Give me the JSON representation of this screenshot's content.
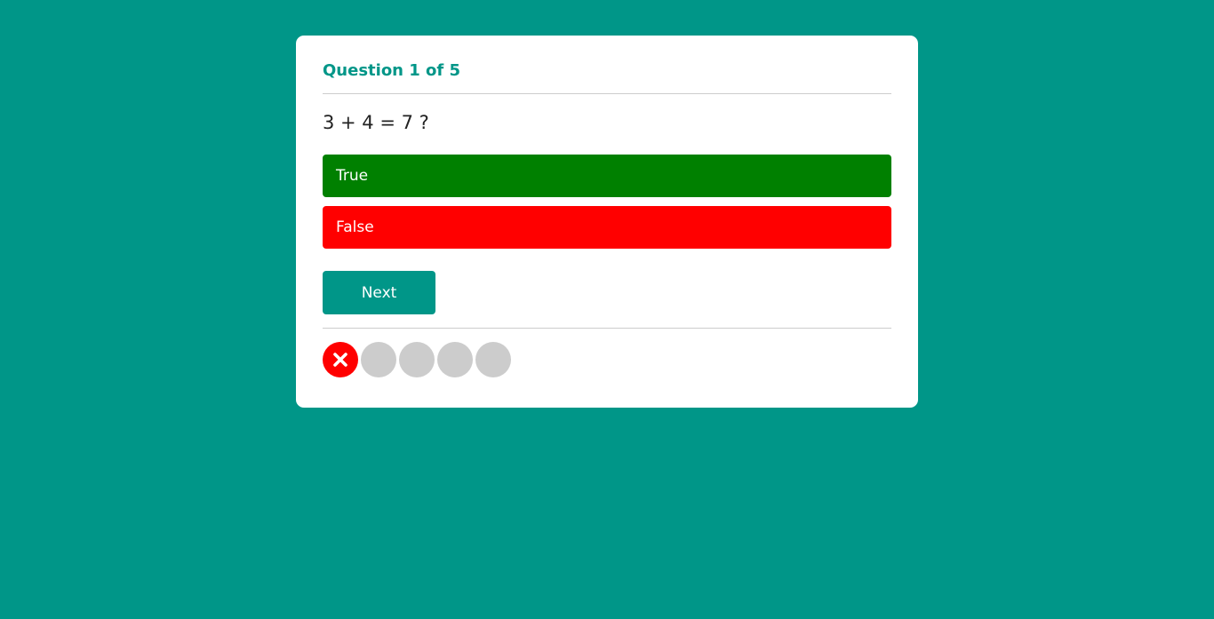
{
  "quiz": {
    "progress_label": "Question 1 of 5",
    "question": "3 + 4 = 7 ?",
    "answers": [
      {
        "label": "True",
        "color": "#008000"
      },
      {
        "label": "False",
        "color": "#ff0000"
      }
    ],
    "next_label": "Next",
    "results": [
      {
        "state": "wrong",
        "icon": "close-icon",
        "color": "#ff0000"
      },
      {
        "state": "pending",
        "color": "#cccccc"
      },
      {
        "state": "pending",
        "color": "#cccccc"
      },
      {
        "state": "pending",
        "color": "#cccccc"
      },
      {
        "state": "pending",
        "color": "#cccccc"
      }
    ]
  },
  "colors": {
    "background": "#009688",
    "accent": "#009688",
    "card": "#ffffff"
  }
}
